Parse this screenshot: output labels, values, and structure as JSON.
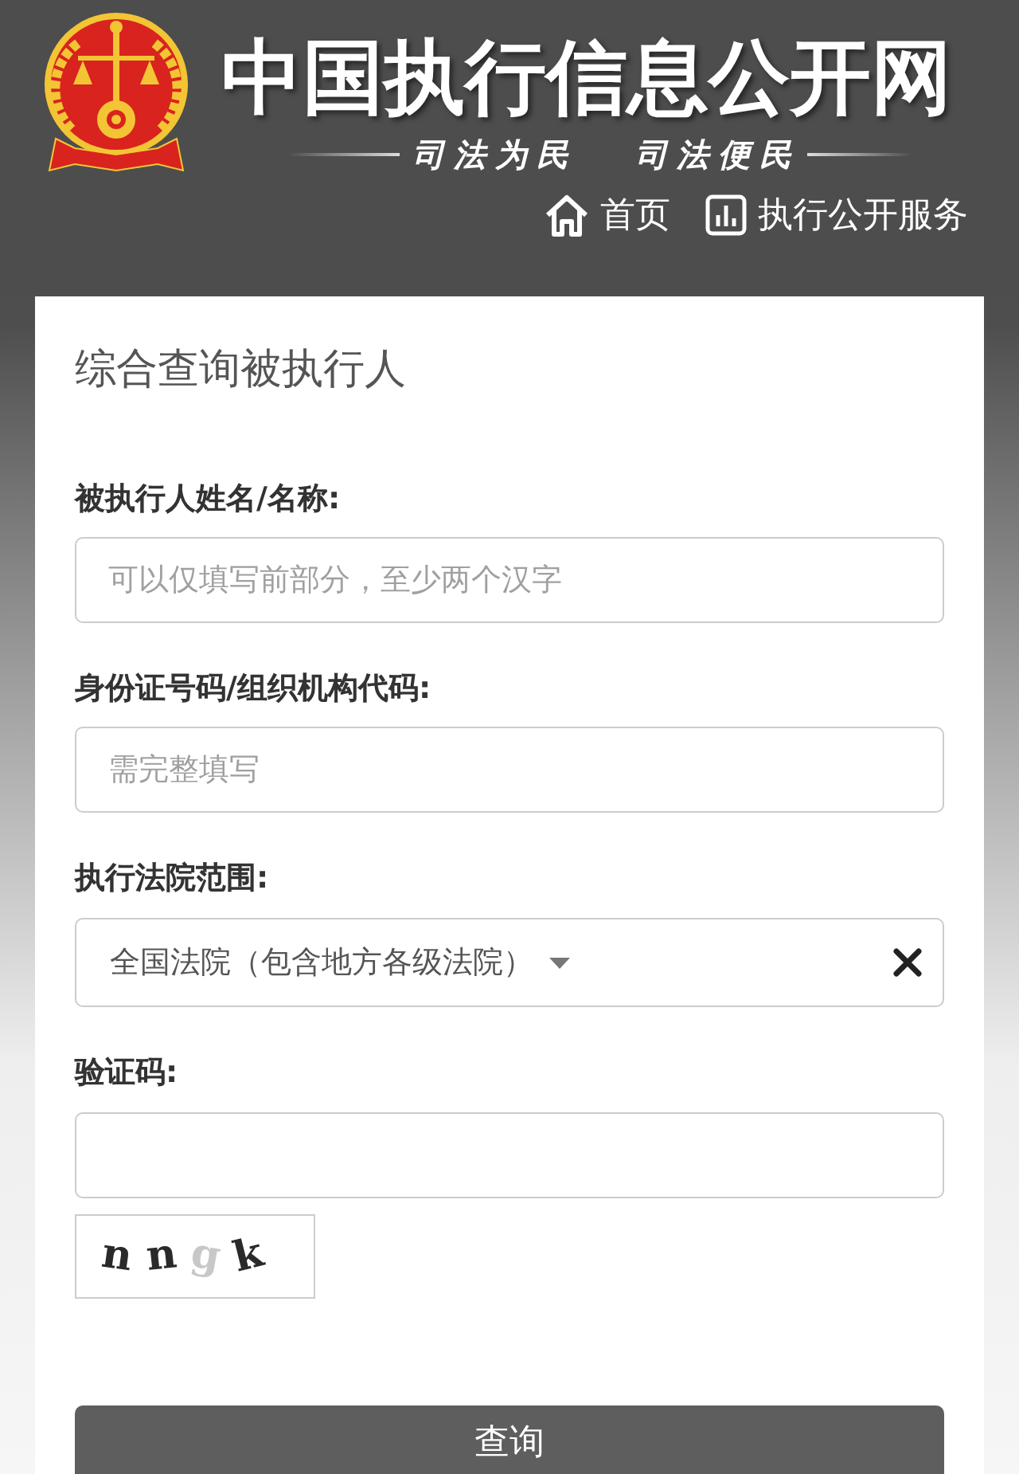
{
  "header": {
    "title": "中国执行信息公开网",
    "slogan": [
      "司法为民",
      "司法便民"
    ],
    "nav": [
      {
        "label": "首页",
        "kind": "home"
      },
      {
        "label": "执行公开服务",
        "kind": "chart"
      }
    ]
  },
  "form": {
    "title": "综合查询被执行人",
    "fields": [
      {
        "kind": "text",
        "label": "被执行人姓名/名称:",
        "placeholder": "可以仅填写前部分，至少两个汉字"
      },
      {
        "kind": "text",
        "label": "身份证号码/组织机构代码:",
        "placeholder": "需完整填写"
      },
      {
        "kind": "select",
        "label": "执行法院范围:",
        "value": "全国法院（包含地方各级法院）"
      },
      {
        "kind": "captcha",
        "label": "验证码:",
        "captcha_text": "nngk"
      }
    ],
    "submit": "查询"
  }
}
